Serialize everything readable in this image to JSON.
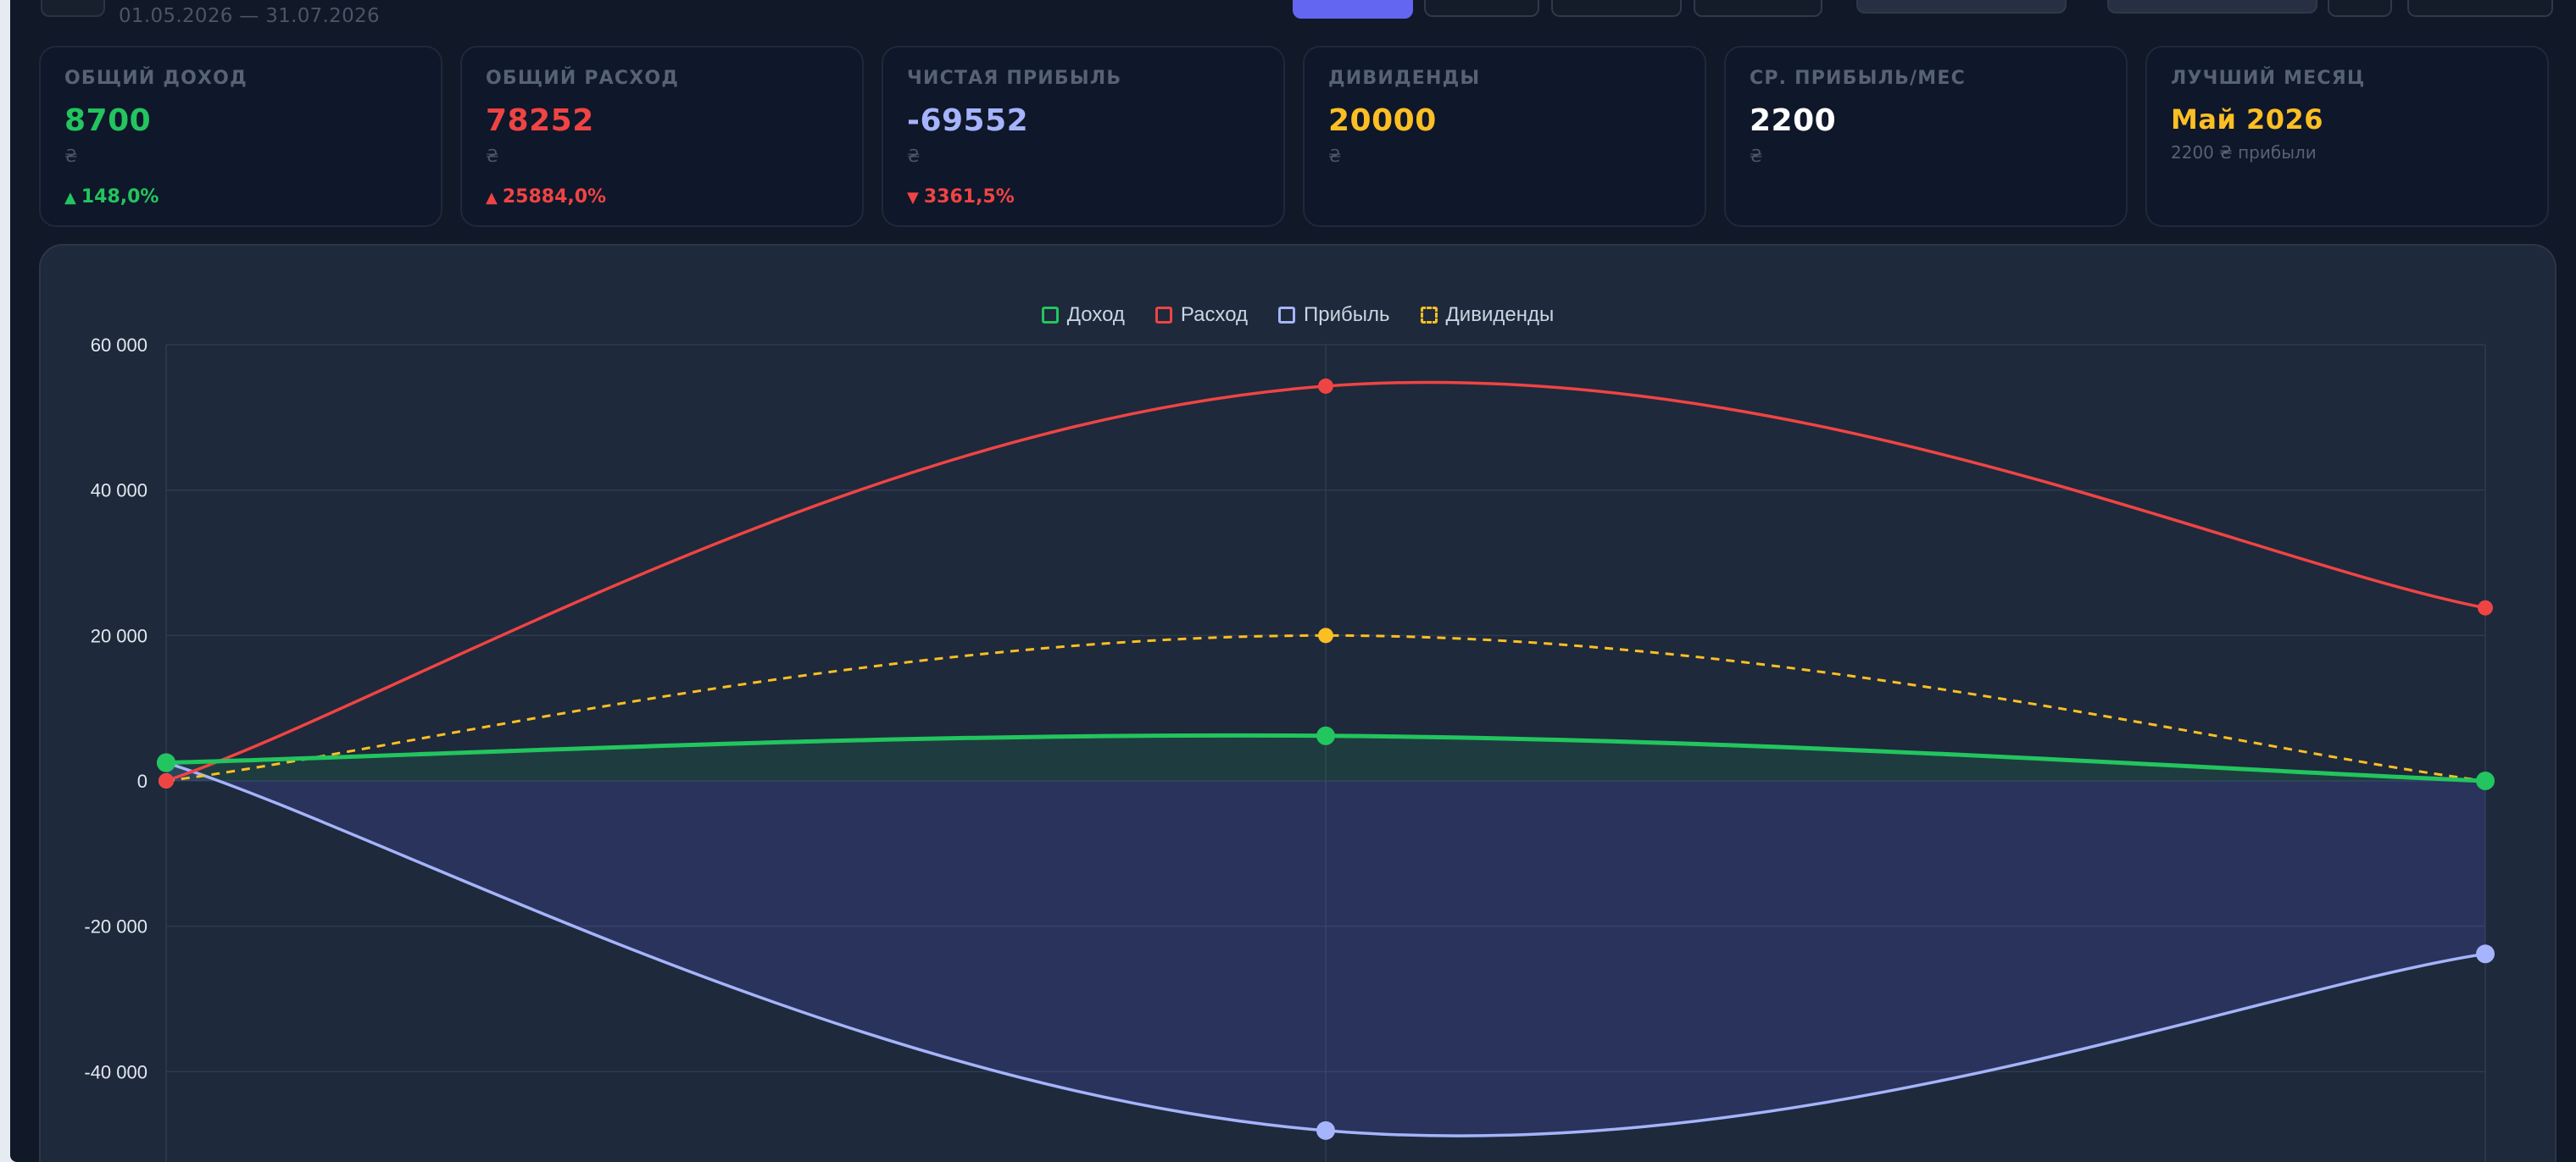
{
  "header": {
    "period": "01.05.2026 — 31.07.2026"
  },
  "kpis": [
    {
      "label": "ОБЩИЙ ДОХОД",
      "value": "8700",
      "unit": "₴",
      "change": "148,0%",
      "direction": "up",
      "value_color": "#22c55e",
      "change_color": "#22c55e"
    },
    {
      "label": "ОБЩИЙ РАСХОД",
      "value": "78252",
      "unit": "₴",
      "change": "25884,0%",
      "direction": "up",
      "value_color": "#ef4444",
      "change_color": "#ef4444"
    },
    {
      "label": "ЧИСТАЯ ПРИБЫЛЬ",
      "value": "-69552",
      "unit": "₴",
      "change": "3361,5%",
      "direction": "down",
      "value_color": "#a5b4fc",
      "change_color": "#ef4444"
    },
    {
      "label": "ДИВИДЕНДЫ",
      "value": "20000",
      "unit": "₴",
      "value_color": "#fbbf24"
    },
    {
      "label": "СР. ПРИБЫЛЬ/МЕС",
      "value": "2200",
      "unit": "₴",
      "value_color": "#ffffff"
    },
    {
      "label": "ЛУЧШИЙ МЕСЯЦ",
      "value": "Май 2026",
      "sub": "2200 ₴ прибыли",
      "value_color": "#fbbf24"
    }
  ],
  "chart_data": {
    "type": "line",
    "y_ticks": [
      "60 000",
      "40 000",
      "20 000",
      "0",
      "-20 000",
      "-40 000"
    ],
    "y_tick_values": [
      60000,
      40000,
      20000,
      0,
      -20000,
      -40000
    ],
    "ylim": [
      -60000,
      60000
    ],
    "grid": true,
    "legend_position": "top-center",
    "series": [
      {
        "name": "Доход",
        "values": [
          2500,
          6200,
          0
        ],
        "color": "#22c55e",
        "style": "solid",
        "fill": "rgba(34,197,94,0.13)"
      },
      {
        "name": "Расход",
        "values": [
          0,
          54300,
          23800
        ],
        "color": "#ef4444",
        "style": "solid",
        "fill": ""
      },
      {
        "name": "Прибыль",
        "values": [
          2500,
          -48100,
          -23800
        ],
        "color": "#a5b4fc",
        "style": "solid",
        "fill": "rgba(99,102,241,0.18)"
      },
      {
        "name": "Дивиденды",
        "values": [
          0,
          20000,
          0
        ],
        "color": "#fbbf24",
        "style": "dashed",
        "fill": ""
      }
    ]
  }
}
